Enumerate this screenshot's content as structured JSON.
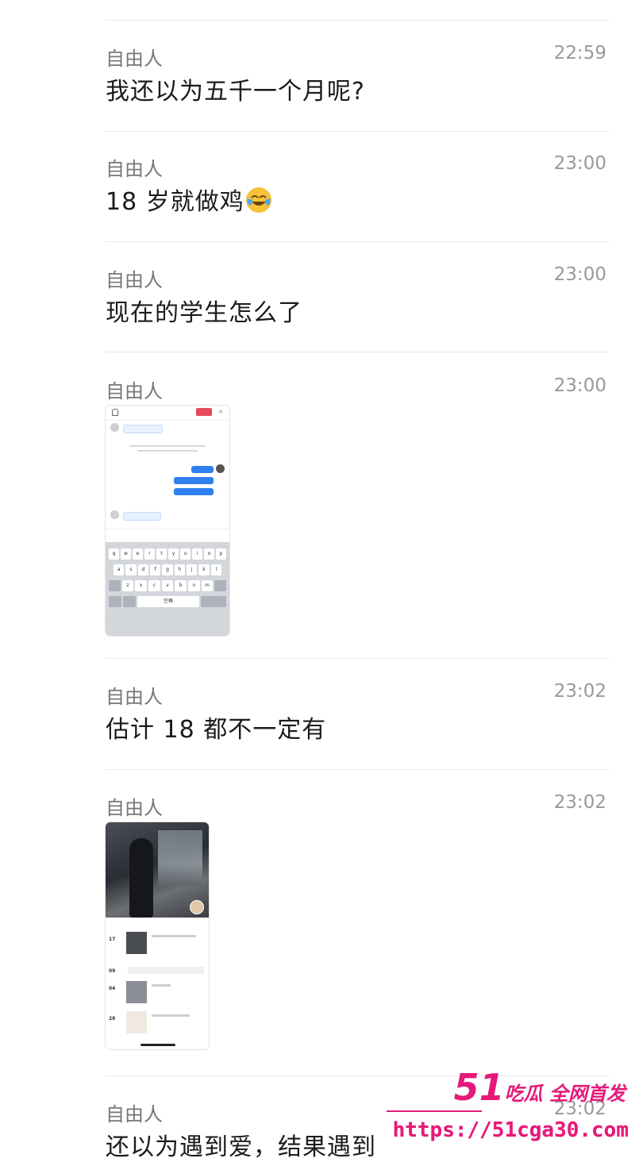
{
  "messages": [
    {
      "name": "自由人",
      "time": "22:59",
      "text": "我还以为五千一个月呢?"
    },
    {
      "name": "自由人",
      "time": "23:00",
      "text": "18 岁就做鸡",
      "emoji": "laughing-crying-face"
    },
    {
      "name": "自由人",
      "time": "23:00",
      "text": "现在的学生怎么了"
    },
    {
      "name": "自由人",
      "time": "23:00",
      "image": "chat-screenshot"
    },
    {
      "name": "自由人",
      "time": "23:02",
      "text": "估计 18 都不一定有"
    },
    {
      "name": "自由人",
      "time": "23:02",
      "image": "profile-screenshot"
    },
    {
      "name": "自由人",
      "time": "23:02",
      "text": "还以为遇到爱，结果遇到"
    }
  ],
  "thumb1": {
    "keyboard_row1": [
      "q",
      "w",
      "e",
      "r",
      "t",
      "y",
      "u",
      "i",
      "o",
      "p"
    ],
    "keyboard_row2": [
      "a",
      "s",
      "d",
      "f",
      "g",
      "h",
      "j",
      "k",
      "l"
    ],
    "keyboard_row3": [
      "z",
      "x",
      "c",
      "v",
      "b",
      "n",
      "m"
    ],
    "space_label": "空格"
  },
  "thumb2": {
    "dates": [
      "17",
      "09",
      "04",
      "28"
    ]
  },
  "watermark": {
    "brand_number": "51",
    "brand_text": "吃瓜 全网首发",
    "url": "https://51cga30.com"
  },
  "colors": {
    "watermark": "#e6197a"
  }
}
